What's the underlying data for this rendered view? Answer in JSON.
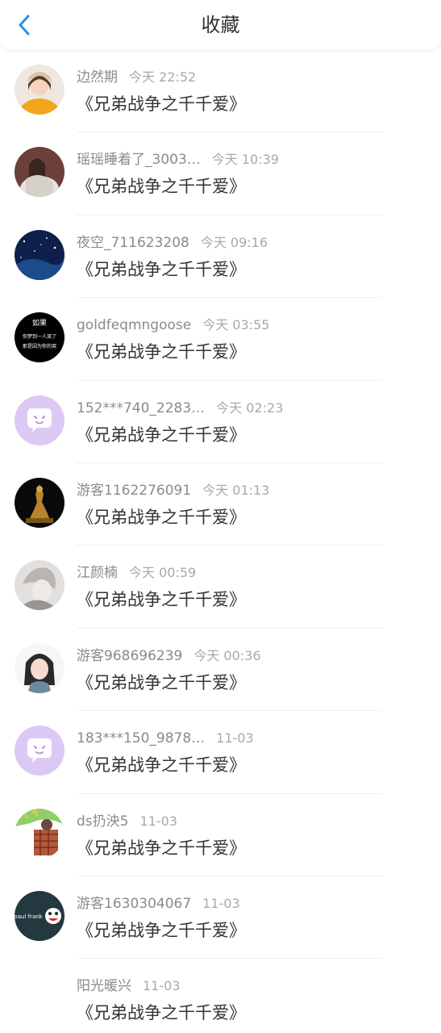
{
  "header": {
    "title": "收藏",
    "back_icon": "chevron-left-icon",
    "accent": "#2b8ef0"
  },
  "items": [
    {
      "name": "边然期",
      "time": "今天 22:52",
      "book": "《兄弟战争之千千爱》"
    },
    {
      "name": "瑶瑶睡着了_3003…",
      "time": "今天 10:39",
      "book": "《兄弟战争之千千爱》"
    },
    {
      "name": "夜空_711623208",
      "time": "今天 09:16",
      "book": "《兄弟战争之千千爱》"
    },
    {
      "name": "goldfeqmngoose",
      "time": "今天 03:55",
      "book": "《兄弟战争之千千爱》"
    },
    {
      "name": "152***740_2283…",
      "time": "今天 02:23",
      "book": "《兄弟战争之千千爱》"
    },
    {
      "name": "游客1162276091",
      "time": "今天 01:13",
      "book": "《兄弟战争之千千爱》"
    },
    {
      "name": "江颜楠",
      "time": "今天 00:59",
      "book": "《兄弟战争之千千爱》"
    },
    {
      "name": "游客968696239",
      "time": "今天 00:36",
      "book": "《兄弟战争之千千爱》"
    },
    {
      "name": "183***150_9878…",
      "time": "11-03",
      "book": "《兄弟战争之千千爱》"
    },
    {
      "name": "ds扔泱5",
      "time": "11-03",
      "book": "《兄弟战争之千千爱》"
    },
    {
      "name": "游客1630304067",
      "time": "11-03",
      "book": "《兄弟战争之千千爱》"
    },
    {
      "name": "阳光暖兴",
      "time": "11-03",
      "book": "《兄弟战争之千千爱》"
    }
  ],
  "avatar_texts": {
    "goldfeqmngoose_lines": [
      "如果",
      "你梦到一人哭了",
      "那是因为你的哭"
    ],
    "paul_frank_logo": "paul frank"
  }
}
